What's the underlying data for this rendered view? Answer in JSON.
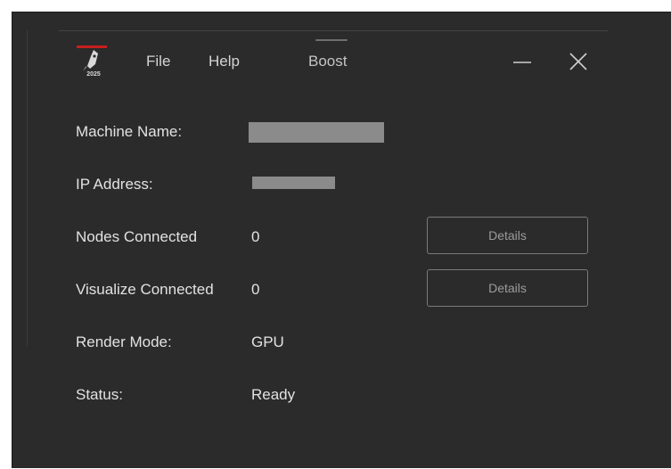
{
  "app": {
    "logo_text": "2025",
    "logo_icon": "rocket-logo-icon"
  },
  "menu": {
    "file": "File",
    "help": "Help",
    "boost": "Boost"
  },
  "window_controls": {
    "minimize_icon": "minimize-icon",
    "close_icon": "close-icon"
  },
  "info": {
    "machine_name": {
      "label": "Machine Name:"
    },
    "ip_address": {
      "label": "IP Address:"
    },
    "nodes_connected": {
      "label": "Nodes Connected",
      "value": "0",
      "button": "Details"
    },
    "visualize_connected": {
      "label": "Visualize Connected",
      "value": "0",
      "button": "Details"
    },
    "render_mode": {
      "label": "Render Mode:",
      "value": "GPU"
    },
    "status": {
      "label": "Status:",
      "value": "Ready"
    }
  },
  "colors": {
    "background": "#2b2b2b",
    "text": "#e2e2e2",
    "muted_text": "#9c9c9c",
    "border": "#7a7a7a",
    "redaction": "#8b8b8b",
    "logo_accent": "#c81e1e"
  }
}
